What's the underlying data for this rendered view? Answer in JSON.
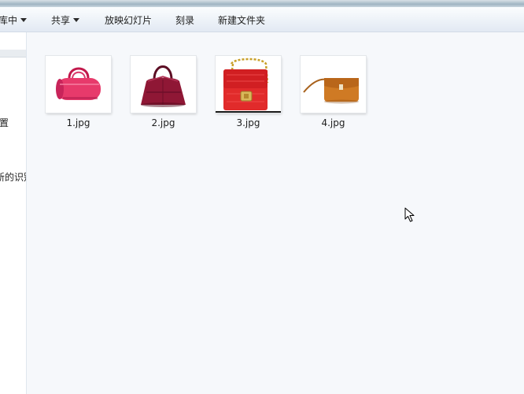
{
  "toolbar": {
    "library_label": "库中",
    "share_label": "共享",
    "slideshow_label": "放映幻灯片",
    "burn_label": "刻录",
    "new_folder_label": "新建文件夹"
  },
  "nav_pane": {
    "item_1": "置",
    "item_2": "新的识别"
  },
  "files": [
    {
      "name": "1.jpg",
      "thumbnail": "pink-barrel-handbag"
    },
    {
      "name": "2.jpg",
      "thumbnail": "burgundy-tote-handbag"
    },
    {
      "name": "3.jpg",
      "thumbnail": "red-chain-shoulder-bag"
    },
    {
      "name": "4.jpg",
      "thumbnail": "tan-crossbody-bag"
    }
  ],
  "colors": {
    "background": "#f6f8fb",
    "toolbar_top": "#fbfdfe",
    "toolbar_bottom": "#e2e9f3"
  },
  "icons": [
    "dropdown-caret-icon",
    "mouse-cursor-icon"
  ]
}
